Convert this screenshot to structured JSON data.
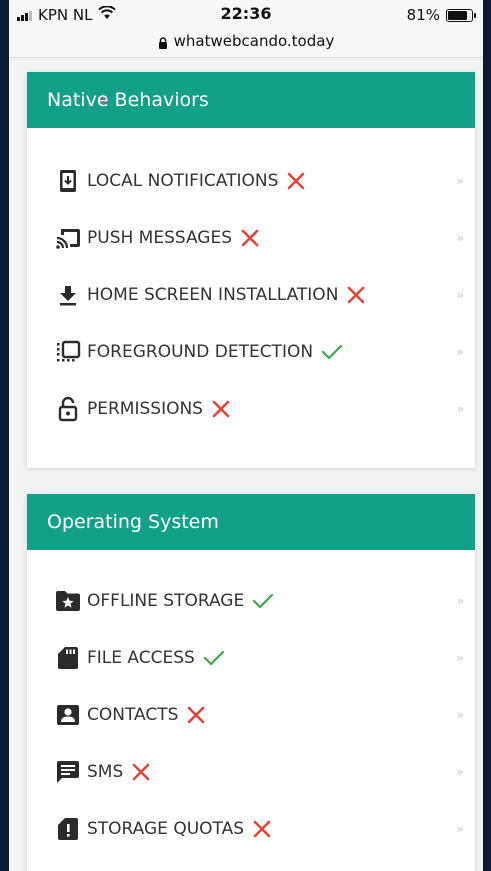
{
  "status_bar": {
    "carrier": "KPN NL",
    "time": "22:36",
    "battery_percent": "81%",
    "battery_level": 0.81,
    "url": "whatwebcando.today"
  },
  "sections": [
    {
      "title": "Native Behaviors",
      "items": [
        {
          "label": "LOCAL NOTIFICATIONS",
          "icon": "phone-notification-icon",
          "supported": false
        },
        {
          "label": "PUSH MESSAGES",
          "icon": "cast-icon",
          "supported": false
        },
        {
          "label": "HOME SCREEN INSTALLATION",
          "icon": "download-icon",
          "supported": false
        },
        {
          "label": "FOREGROUND DETECTION",
          "icon": "selection-icon",
          "supported": true
        },
        {
          "label": "PERMISSIONS",
          "icon": "unlock-icon",
          "supported": false
        }
      ]
    },
    {
      "title": "Operating System",
      "items": [
        {
          "label": "OFFLINE STORAGE",
          "icon": "folder-star-icon",
          "supported": true
        },
        {
          "label": "FILE ACCESS",
          "icon": "sd-card-icon",
          "supported": true
        },
        {
          "label": "CONTACTS",
          "icon": "contact-card-icon",
          "supported": false
        },
        {
          "label": "SMS",
          "icon": "message-icon",
          "supported": false
        },
        {
          "label": "STORAGE QUOTAS",
          "icon": "storage-alert-icon",
          "supported": false
        }
      ]
    }
  ],
  "chevron": "»",
  "colors": {
    "header": "#12a088",
    "cross": "#e0443a",
    "check": "#3aa84a",
    "icon": "#2b2b2b"
  }
}
